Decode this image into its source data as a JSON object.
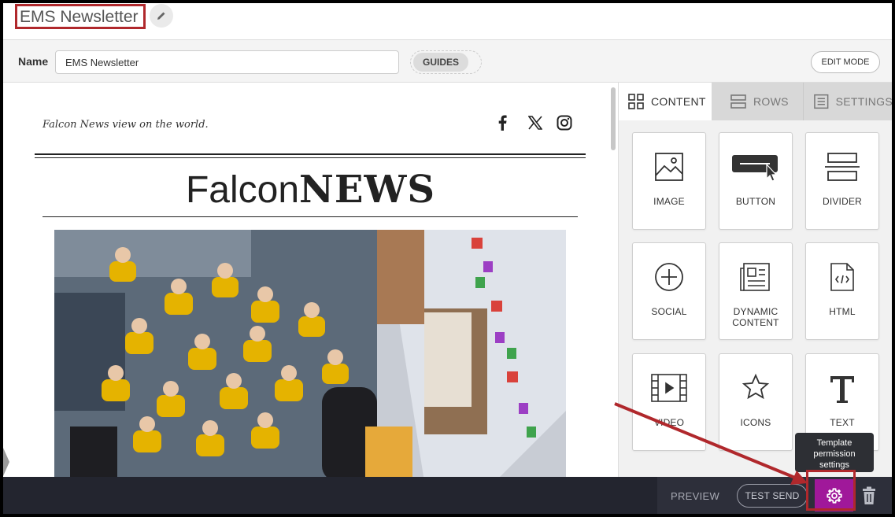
{
  "header": {
    "title": "EMS Newsletter"
  },
  "name_bar": {
    "label": "Name",
    "value": "EMS Newsletter",
    "guides_label": "GUIDES",
    "edit_mode_label": "EDIT MODE"
  },
  "newsletter": {
    "tagline": "Falcon News view on the world.",
    "masthead_light": "Falcon",
    "masthead_bold": "NEWS",
    "social_icons": [
      "facebook-icon",
      "x-icon",
      "instagram-icon"
    ]
  },
  "panel": {
    "tabs": [
      {
        "label": "CONTENT",
        "icon": "grid-icon",
        "active": true
      },
      {
        "label": "ROWS",
        "icon": "rows-icon",
        "active": false
      },
      {
        "label": "SETTINGS",
        "icon": "list-icon",
        "active": false
      }
    ],
    "tiles": [
      {
        "label": "IMAGE",
        "icon": "image-icon"
      },
      {
        "label": "BUTTON",
        "icon": "button-icon"
      },
      {
        "label": "DIVIDER",
        "icon": "divider-icon"
      },
      {
        "label": "SOCIAL",
        "icon": "plus-circle-icon"
      },
      {
        "label": "DYNAMIC CONTENT",
        "icon": "dynamic-content-icon"
      },
      {
        "label": "HTML",
        "icon": "html-file-icon"
      },
      {
        "label": "VIDEO",
        "icon": "video-icon"
      },
      {
        "label": "ICONS",
        "icon": "star-icon"
      },
      {
        "label": "TEXT",
        "icon": "text-icon"
      }
    ]
  },
  "bottom_bar": {
    "preview_label": "PREVIEW",
    "test_send_label": "TEST SEND",
    "tooltip": [
      "Template",
      "permission",
      "settings"
    ]
  },
  "colors": {
    "highlight_red": "#b0282c",
    "settings_accent": "#a0189a",
    "bottom_bar": "#23252f"
  }
}
